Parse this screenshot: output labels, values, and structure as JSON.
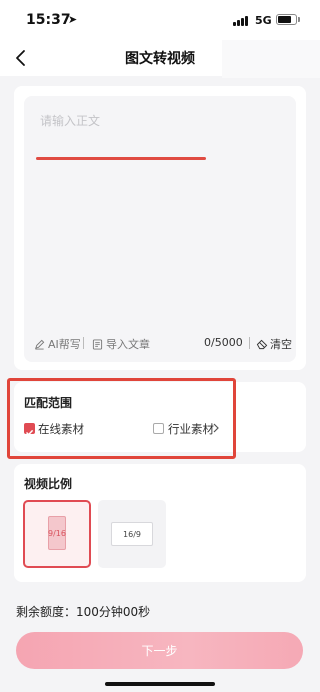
{
  "status_bar": {
    "time": "15:37",
    "network": "5G",
    "battery_level": 0.75,
    "icons": [
      "location-arrow-icon",
      "signal-icon",
      "battery-icon"
    ]
  },
  "nav": {
    "title": "图文转视频",
    "back_icon": "chevron-left-icon"
  },
  "editor": {
    "placeholder": "请输入正文",
    "ai_write_label": "AI帮写",
    "import_label": "导入文章",
    "char_count": "0/5000",
    "clear_label": "清空",
    "accent_line_color": "#e04b42"
  },
  "match_range": {
    "title": "匹配范围",
    "options": [
      {
        "label": "在线素材",
        "checked": true
      },
      {
        "label": "行业素材",
        "checked": false
      }
    ],
    "highlight_color": "#e0453a"
  },
  "video_ratio": {
    "title": "视频比例",
    "options": [
      {
        "label": "9/16",
        "selected": true
      },
      {
        "label": "16/9",
        "selected": false
      }
    ]
  },
  "footer": {
    "quota_text": "剩余额度：100分钟00秒",
    "next_label": "下一步"
  },
  "colors": {
    "accent": "#e04b53",
    "next_button": "#f6b0bb"
  }
}
